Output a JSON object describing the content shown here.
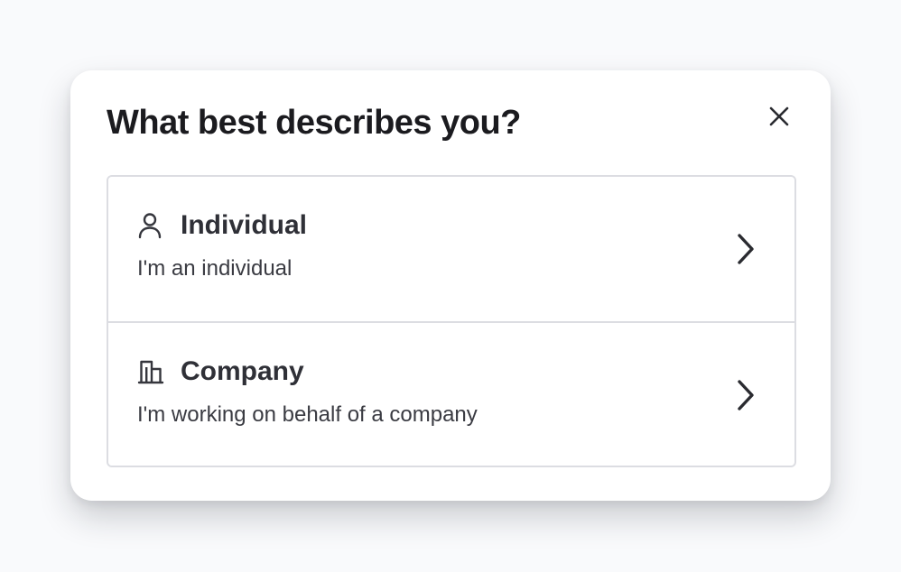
{
  "dialog": {
    "title": "What best describes you?",
    "close_icon": "close-icon"
  },
  "options": [
    {
      "title": "Individual",
      "description": "I'm an individual",
      "icon": "person-icon"
    },
    {
      "title": "Company",
      "description": "I'm working on behalf of a company",
      "icon": "building-icon"
    }
  ],
  "colors": {
    "background": "#f9fafc",
    "card": "#ffffff",
    "border": "#dcdde2",
    "title_text": "#1b1b1f",
    "option_text": "#2f3037"
  }
}
